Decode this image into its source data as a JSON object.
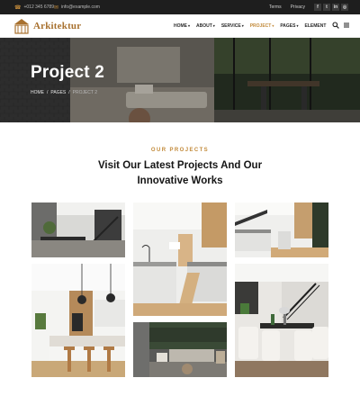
{
  "topbar": {
    "phone": "+012 345 6789",
    "email": "info@example.com",
    "links": [
      "Terms",
      "Privacy"
    ],
    "socials": [
      {
        "icon": "facebook-icon",
        "glyph": "f"
      },
      {
        "icon": "twitter-icon",
        "glyph": "t"
      },
      {
        "icon": "linkedin-icon",
        "glyph": "in"
      },
      {
        "icon": "instagram-icon",
        "glyph": "◎"
      }
    ]
  },
  "header": {
    "logo_text": "Arkitektur",
    "nav": [
      {
        "label": "HOME",
        "dropdown": true,
        "active": false
      },
      {
        "label": "ABOUT",
        "dropdown": true,
        "active": false
      },
      {
        "label": "SERVICE",
        "dropdown": true,
        "active": false
      },
      {
        "label": "PROJECT",
        "dropdown": true,
        "active": true
      },
      {
        "label": "PAGES",
        "dropdown": true,
        "active": false
      },
      {
        "label": "ELEMENT",
        "dropdown": false,
        "active": false
      }
    ]
  },
  "hero": {
    "title": "Project 2",
    "breadcrumb": [
      "HOME",
      "/",
      "PAGES",
      "/",
      "PROJECT 2"
    ]
  },
  "section": {
    "eyebrow": "OUR PROJECTS",
    "heading_line1": "Visit Our Latest Projects And Our",
    "heading_line2": "Innovative Works"
  },
  "colors": {
    "accent": "#c28a3a",
    "dark": "#1e1e1e"
  }
}
